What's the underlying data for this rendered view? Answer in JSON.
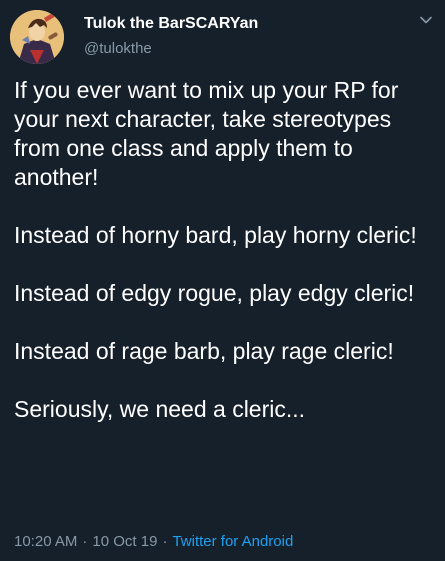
{
  "tweet": {
    "author": {
      "display_name": "Tulok the BarSCARYan",
      "handle": "@tulokthe",
      "avatar_icon": "avatar-illustration"
    },
    "menu_icon": "chevron-down-icon",
    "paragraphs": [
      "If you ever want to mix up your RP for your next character, take stereotypes from one class and apply them to another!",
      "Instead of horny bard, play horny cleric!",
      "Instead of edgy rogue, play edgy cleric!",
      "Instead of rage barb, play rage cleric!",
      "Seriously, we need a cleric..."
    ],
    "meta": {
      "time": "10:20 AM",
      "separator": "·",
      "date": "10 Oct 19",
      "source": "Twitter for Android"
    }
  },
  "colors": {
    "background": "#15202b",
    "text_primary": "#ffffff",
    "text_secondary": "#8899a6",
    "link": "#1da1f2"
  }
}
